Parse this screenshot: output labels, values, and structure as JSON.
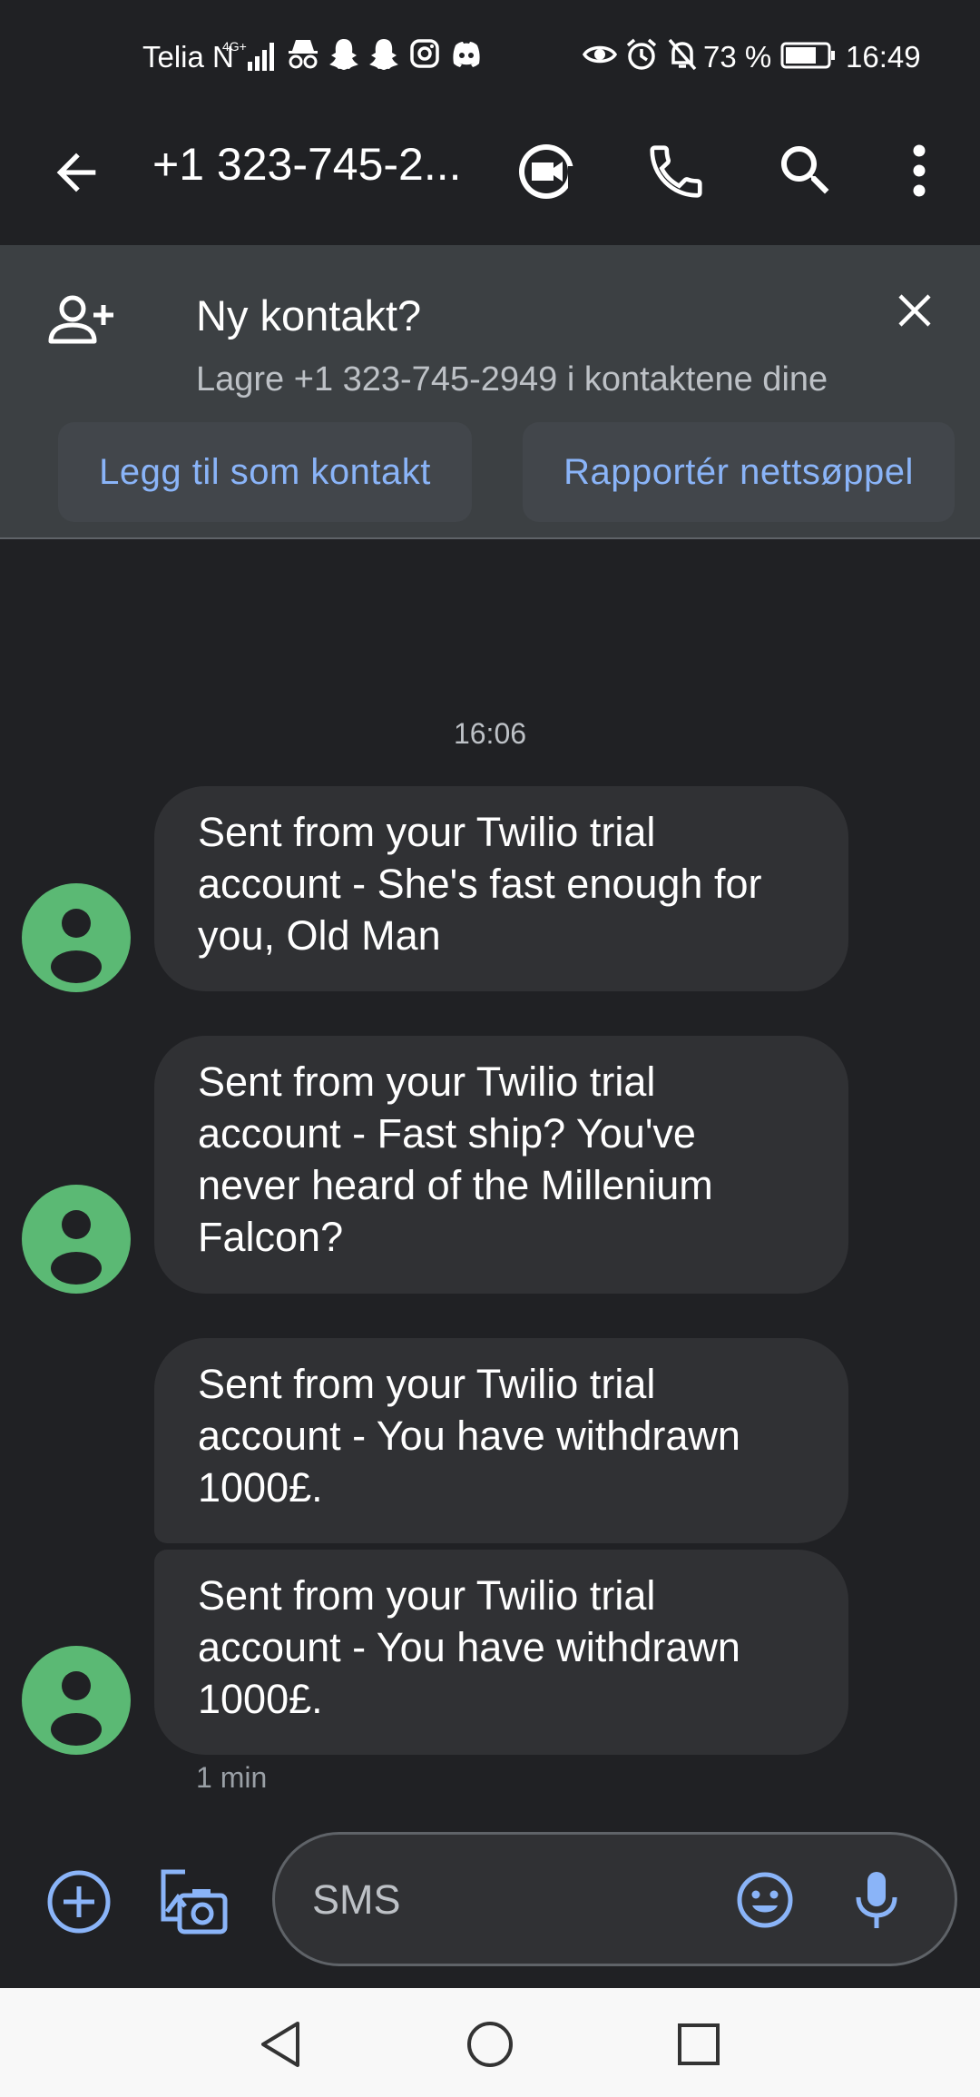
{
  "status_bar": {
    "carrier": "Telia N",
    "network": "4G+",
    "battery_percent": "73 %",
    "time": "16:49",
    "icons": [
      "signal-icon",
      "incognito-icon",
      "snapchat-icon",
      "snapchat-icon",
      "instagram-icon",
      "discord-icon",
      "eye-icon",
      "alarm-icon",
      "bell-off-icon",
      "battery-icon"
    ]
  },
  "app_bar": {
    "contact": "+1 323-745-2...",
    "icons": [
      "back-arrow-icon",
      "video-call-icon",
      "phone-icon",
      "search-icon",
      "more-vert-icon"
    ]
  },
  "banner": {
    "title": "Ny kontakt?",
    "subtitle": "Lagre +1 323-745-2949 i kontaktene dine",
    "add_contact_label": "Legg til som kontakt",
    "report_spam_label": "Rapportér nettsøppel"
  },
  "conversation": {
    "timestamp": "16:06",
    "messages": [
      {
        "lines": [
          "Sent from your Twilio trial",
          "account - She's fast enough for",
          "you, Old Man"
        ]
      },
      {
        "lines": [
          "Sent from your Twilio trial",
          "account - Fast ship? You've",
          "never heard of the Millenium",
          "Falcon?"
        ]
      },
      {
        "lines": [
          "Sent from your Twilio trial",
          "account - You have withdrawn",
          "1000£."
        ]
      },
      {
        "lines": [
          "Sent from your Twilio trial",
          "account - You have withdrawn",
          "1000£."
        ]
      }
    ],
    "last_message_time": "1 min"
  },
  "compose": {
    "placeholder": "SMS"
  },
  "colors": {
    "background": "#202124",
    "banner": "#3c4043",
    "bubble": "#303134",
    "accent": "#8ab4f8",
    "avatar": "#5bb974"
  }
}
